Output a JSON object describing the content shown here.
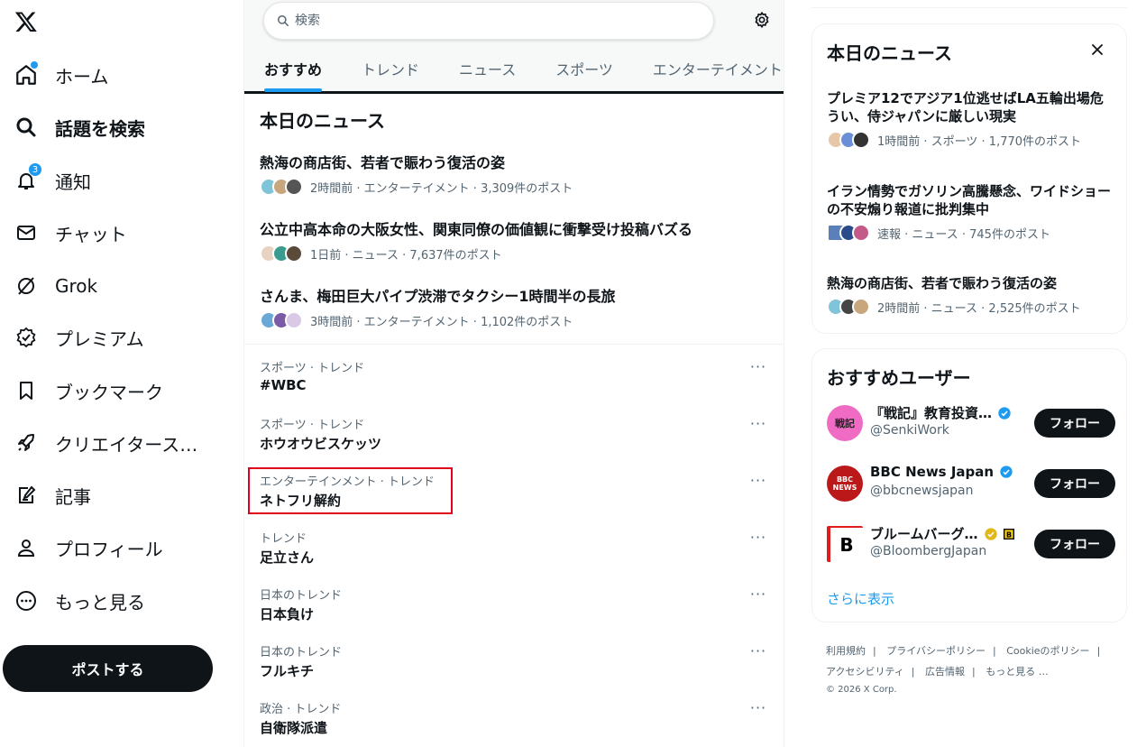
{
  "nav": {
    "items": [
      {
        "label": "ホーム",
        "icon": "home-icon"
      },
      {
        "label": "話題を検索",
        "icon": "search-icon"
      },
      {
        "label": "通知",
        "icon": "bell-icon",
        "badge": "3"
      },
      {
        "label": "チャット",
        "icon": "mail-icon"
      },
      {
        "label": "Grok",
        "icon": "grok-icon"
      },
      {
        "label": "プレミアム",
        "icon": "premium-icon"
      },
      {
        "label": "ブックマーク",
        "icon": "bookmark-icon"
      },
      {
        "label": "クリエイタース…",
        "icon": "rocket-icon"
      },
      {
        "label": "記事",
        "icon": "article-icon"
      },
      {
        "label": "プロフィール",
        "icon": "person-icon"
      },
      {
        "label": "もっと見る",
        "icon": "more-circle-icon"
      }
    ],
    "post_button": "ポストする"
  },
  "search": {
    "placeholder": "検索"
  },
  "tabs": [
    "おすすめ",
    "トレンド",
    "ニュース",
    "スポーツ",
    "エンターテイメント"
  ],
  "today_news": {
    "title": "本日のニュース",
    "items": [
      {
        "headline": "熱海の商店街、若者で賑わう復活の姿",
        "meta": "2時間前 · エンターテイメント · 3,309件のポスト"
      },
      {
        "headline": "公立中高本命の大阪女性、関東同僚の価値観に衝撃受け投稿バズる",
        "meta": "1日前 · ニュース · 7,637件のポスト"
      },
      {
        "headline": "さんま、梅田巨大パイプ渋滞でタクシー1時間半の長旅",
        "meta": "3時間前 · エンターテイメント · 1,102件のポスト"
      }
    ]
  },
  "trends": [
    {
      "category": "スポーツ · トレンド",
      "name": "#WBC"
    },
    {
      "category": "スポーツ · トレンド",
      "name": "ホウオウビスケッツ"
    },
    {
      "category": "エンターテインメント · トレンド",
      "name": "ネトフリ解約"
    },
    {
      "category": "トレンド",
      "name": "足立さん"
    },
    {
      "category": "日本のトレンド",
      "name": "日本負け"
    },
    {
      "category": "日本のトレンド",
      "name": "フルキチ"
    },
    {
      "category": "政治 · トレンド",
      "name": "自衛隊派遣"
    }
  ],
  "right_news": {
    "title": "本日のニュース",
    "items": [
      {
        "headline": "プレミア12でアジア1位逃せばLA五輪出場危うい、侍ジャパンに厳しい現実",
        "meta": "1時間前 · スポーツ · 1,770件のポスト"
      },
      {
        "headline": "イラン情勢でガソリン高騰懸念、ワイドショーの不安煽り報道に批判集中",
        "meta": "速報 · ニュース · 745件のポスト"
      },
      {
        "headline": "熱海の商店街、若者で賑わう復活の姿",
        "meta": "2時間前 · ニュース · 2,525件のポスト"
      }
    ]
  },
  "who_to_follow": {
    "title": "おすすめユーザー",
    "users": [
      {
        "name": "『戦記』教育投資…",
        "handle": "@SenkiWork",
        "avatar_text": "戦記",
        "avatar_color": "#f06bc4",
        "verified": "blue"
      },
      {
        "name": "BBC News Japan",
        "handle": "@bbcnewsjapan",
        "avatar_text": "BBC NEWS",
        "avatar_color": "#bb1919",
        "verified": "blue"
      },
      {
        "name": "ブルームバーグ…",
        "handle": "@BloombergJapan",
        "avatar_text": "B",
        "avatar_color": "#ffffff",
        "verified": "gold"
      }
    ],
    "follow_label": "フォロー",
    "show_more": "さらに表示"
  },
  "footer": {
    "links": [
      "利用規約",
      "プライバシーポリシー",
      "Cookieのポリシー",
      "アクセシビリティ",
      "広告情報",
      "もっと見る …"
    ],
    "copyright": "© 2026 X Corp."
  },
  "colors": {
    "accent": "#1d9bf0",
    "text": "#0f1419",
    "muted": "#536471",
    "highlight": "#e0001b"
  }
}
